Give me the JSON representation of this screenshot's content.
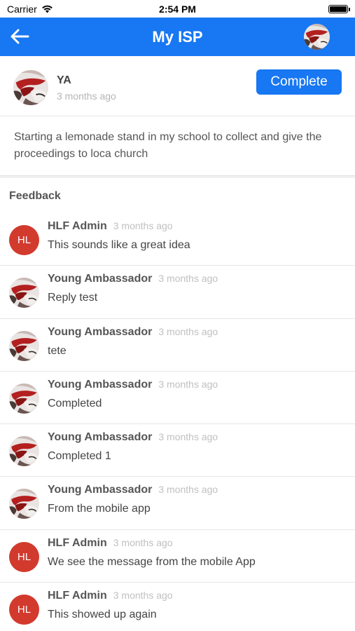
{
  "status_bar": {
    "carrier": "Carrier",
    "time": "2:54 PM"
  },
  "nav": {
    "title": "My ISP",
    "icons": {
      "back": "back-arrow-icon"
    }
  },
  "post": {
    "author": "YA",
    "time": "3 months ago",
    "complete_label": "Complete",
    "body": "Starting a lemonade stand in my school to collect and give the proceedings to loca church"
  },
  "feedback": {
    "title": "Feedback",
    "comments": [
      {
        "author": "HLF Admin",
        "initials": "HL",
        "time": "3 months ago",
        "text": "This sounds like a great idea"
      },
      {
        "author": "Young Ambassador",
        "initials": "",
        "time": "3 months ago",
        "text": "Reply test"
      },
      {
        "author": "Young Ambassador",
        "initials": "",
        "time": "3 months ago",
        "text": "tete"
      },
      {
        "author": "Young Ambassador",
        "initials": "",
        "time": "3 months ago",
        "text": "Completed"
      },
      {
        "author": "Young Ambassador",
        "initials": "",
        "time": "3 months ago",
        "text": "Completed 1"
      },
      {
        "author": "Young Ambassador",
        "initials": "",
        "time": "3 months ago",
        "text": "From the mobile app"
      },
      {
        "author": "HLF Admin",
        "initials": "HL",
        "time": "3 months ago",
        "text": "We see the message from the mobile App"
      },
      {
        "author": "HLF Admin",
        "initials": "HL",
        "time": "3 months ago",
        "text": "This showed up again"
      }
    ]
  },
  "colors": {
    "accent": "#1877f2",
    "admin_avatar": "#d23a2e"
  }
}
